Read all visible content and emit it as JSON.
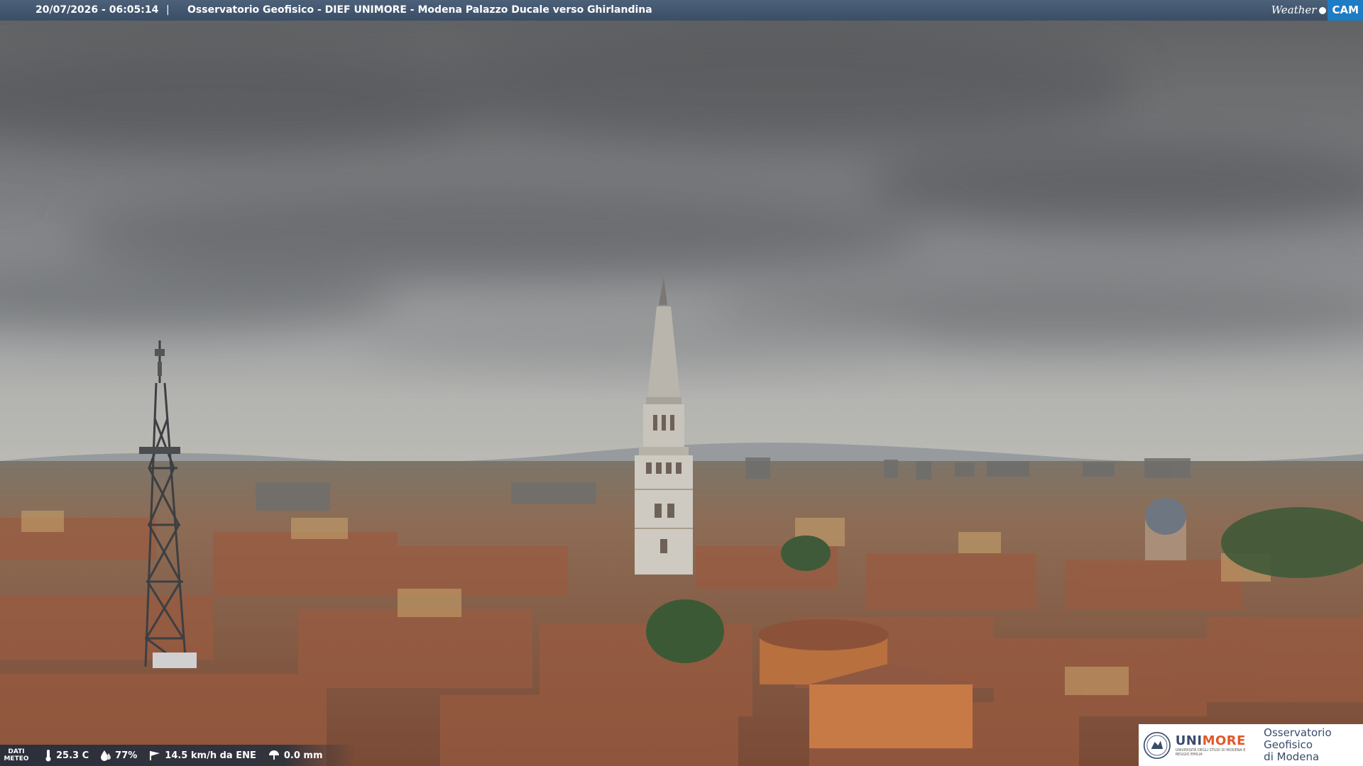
{
  "header": {
    "datetime": "20/07/2026 - 06:05:14",
    "separator": "|",
    "title": "Osservatorio Geofisico - DIEF UNIMORE - Modena Palazzo Ducale verso Ghirlandina",
    "brand_weather": "Weather",
    "brand_cam": "CAM"
  },
  "meteo": {
    "label_line1": "DATI",
    "label_line2": "METEO",
    "temperature": "25.3 C",
    "humidity": "77%",
    "wind": "14.5 km/h da ENE",
    "rain": "0.0 mm",
    "icons": [
      "thermometer-icon",
      "humidity-drop-icon",
      "wind-vane-icon",
      "rain-gauge-icon"
    ]
  },
  "logo": {
    "uni_prefix": "UNI",
    "uni_suffix": "MORE",
    "uni_subtitle": "UNIVERSITÀ DEGLI STUDI DI MODENA E REGGIO EMILIA",
    "observatory_line1": "Osservatorio Geofisico",
    "observatory_line2": "di Modena"
  },
  "colors": {
    "topbar": "#3b4e66",
    "cam_blue": "#1e7cc4",
    "unimore_blue": "#3a4b6c",
    "unimore_orange": "#e2582a"
  }
}
